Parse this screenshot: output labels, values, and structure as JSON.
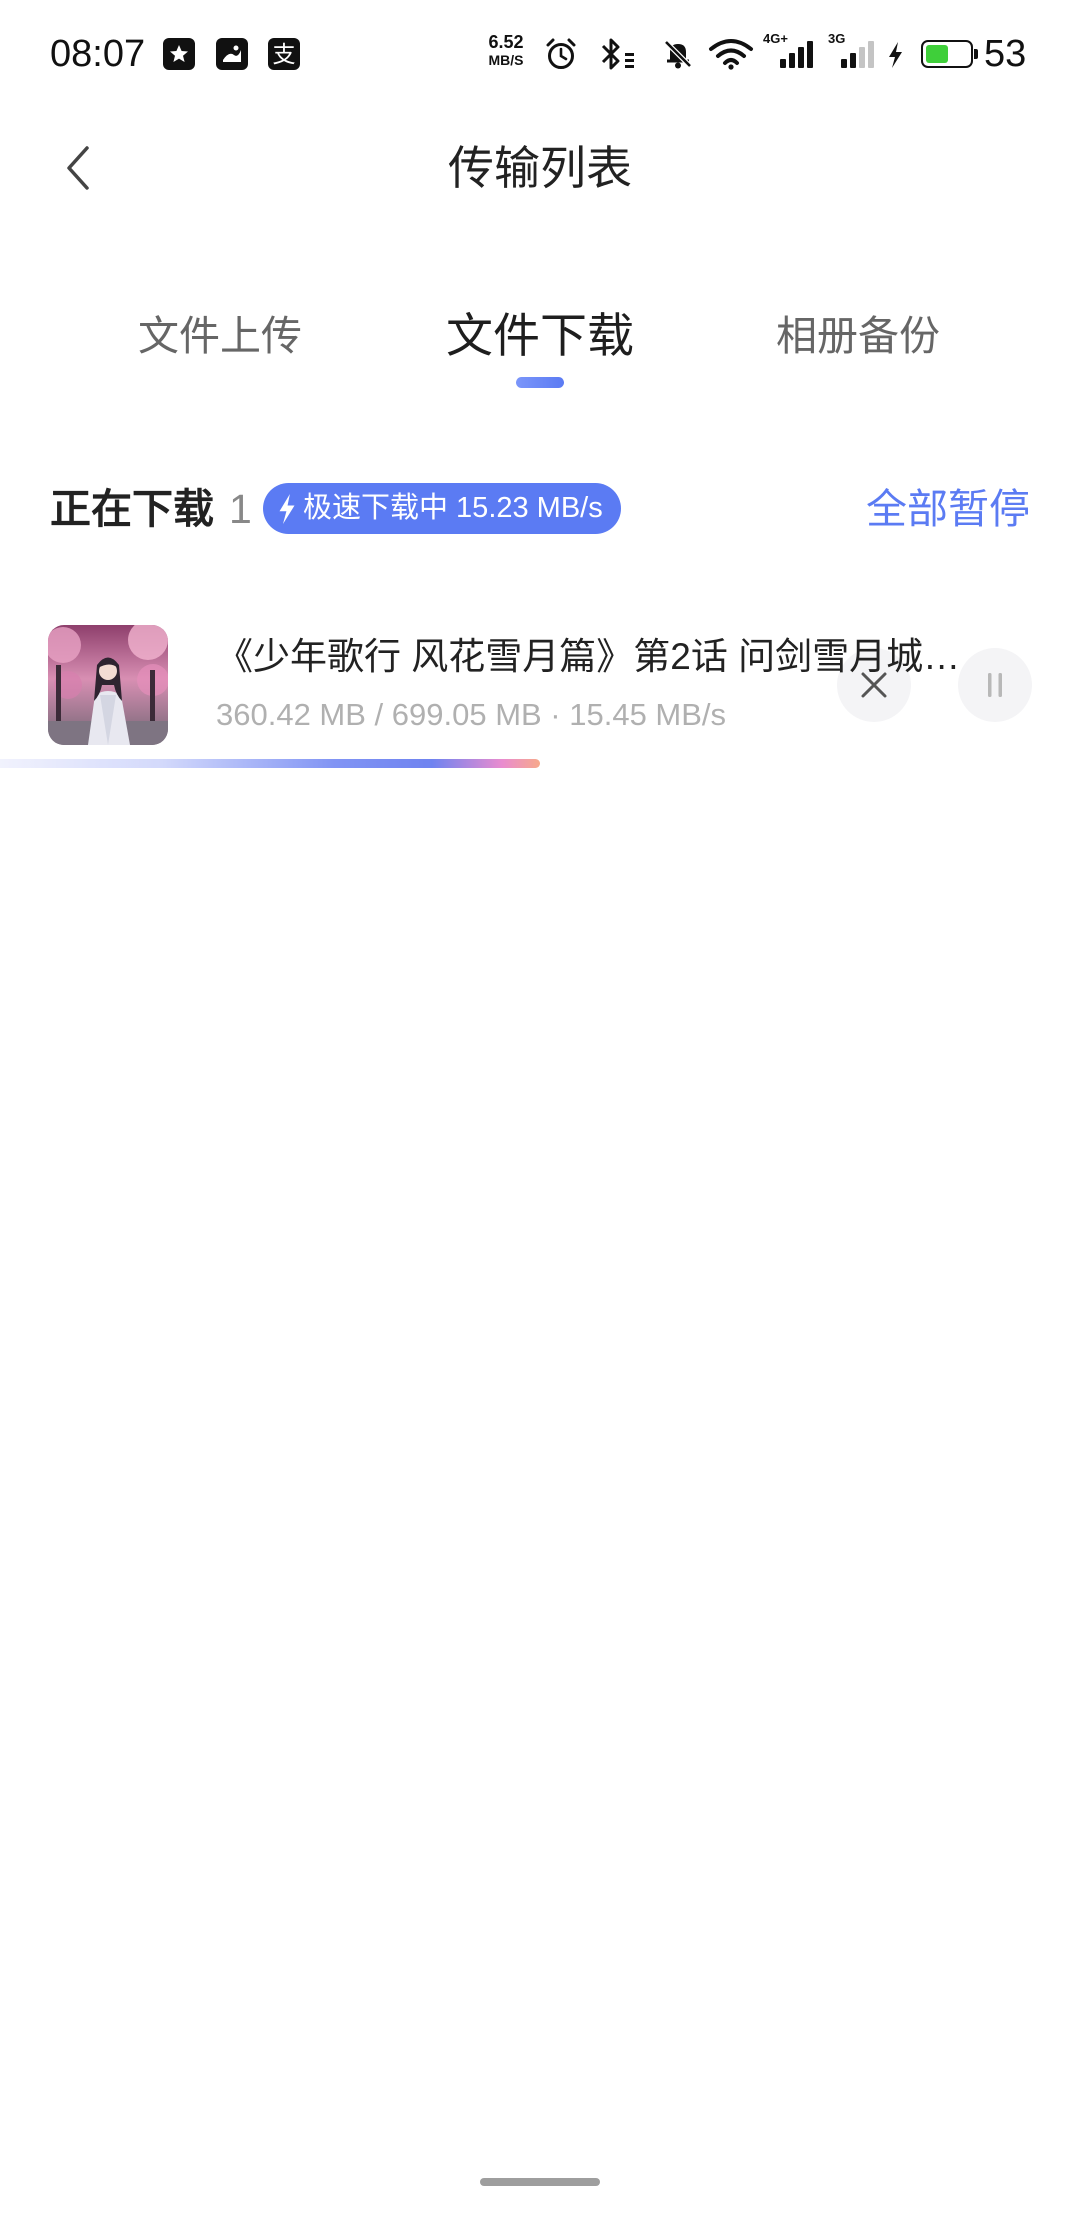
{
  "status_bar": {
    "time": "08:07",
    "alipay_glyph": "支",
    "net_speed_value": "6.52",
    "net_speed_unit": "MB/S",
    "signal_1": {
      "label": "4G+",
      "strength": 4
    },
    "signal_2": {
      "label": "3G",
      "strength": 2
    },
    "battery_level": "53"
  },
  "header": {
    "title": "传输列表"
  },
  "tabs": [
    {
      "label": "文件上传",
      "active": false
    },
    {
      "label": "文件下载",
      "active": true
    },
    {
      "label": "相册备份",
      "active": false
    }
  ],
  "section": {
    "title": "正在下载",
    "count": "1",
    "speed_badge": "极速下载中 15.23 MB/s",
    "pause_all_label": "全部暂停"
  },
  "downloads": [
    {
      "title": "《少年歌行 风花雪月篇》第2话 问剑雪月城…",
      "stats": "360.42 MB / 699.05 MB · 15.45 MB/s",
      "progress": 0.5
    }
  ],
  "icons": {
    "back": "chevron-left-icon",
    "speed_badge": "lightning-icon",
    "cancel": "close-icon",
    "pause": "pause-icon",
    "status": [
      "app-notification-icon",
      "image-notification-icon",
      "alipay-icon",
      "alarm-icon",
      "bluetooth-icon",
      "notifications-muted-icon",
      "wifi-icon",
      "charging-icon",
      "battery-icon"
    ]
  },
  "colors": {
    "accent": "#5b7bf3",
    "text_primary": "#222222",
    "text_secondary": "#666666",
    "text_muted": "#b0b0b0",
    "battery_fill": "#3fcf3a",
    "background": "#ffffff"
  }
}
